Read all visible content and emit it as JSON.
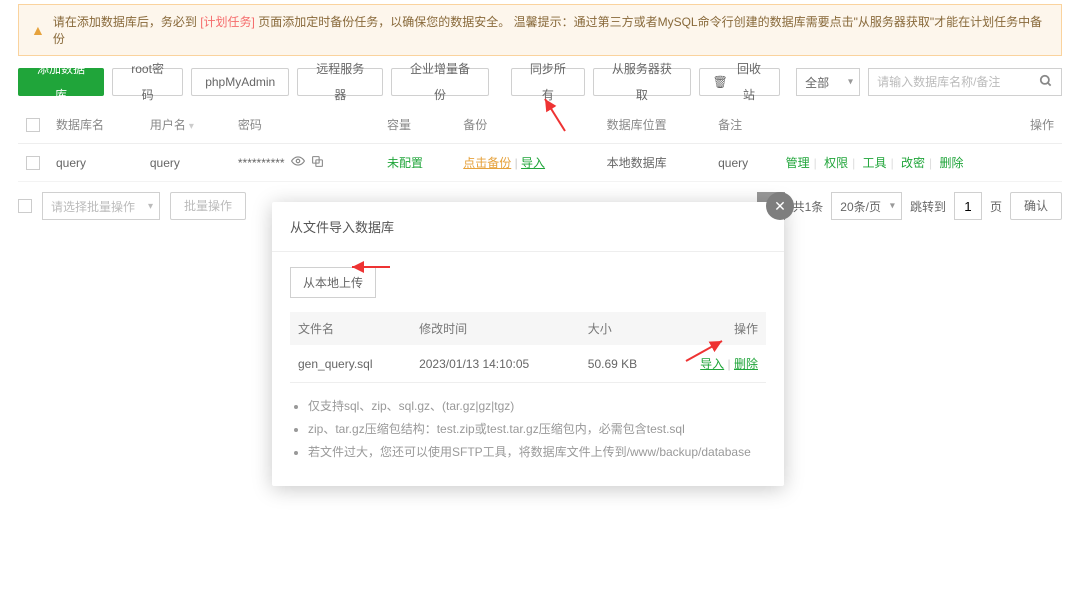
{
  "notice": {
    "prefix": "请在添加数据库后，务必到",
    "link1": "[计划任务]",
    "mid": "页面添加定时备份任务，以确保您的数据安全。 温馨提示：通过第三方或者MySQL命令行创建的数据库需要点击\"从服务器获取\"才能在计划任务中备份"
  },
  "toolbar": {
    "add_db": "添加数据库",
    "root_pwd": "root密码",
    "phpmyadmin": "phpMyAdmin",
    "remote_server": "远程服务器",
    "enterprise_backup": "企业增量备份",
    "sync_all": "同步所有",
    "fetch_server": "从服务器获取",
    "recycle_bin": "回收站",
    "filter_all": "全部"
  },
  "search": {
    "placeholder": "请输入数据库名称/备注"
  },
  "columns": {
    "db_name": "数据库名",
    "user": "用户名",
    "password": "密码",
    "capacity": "容量",
    "backup": "备份",
    "location": "数据库位置",
    "remark": "备注",
    "opt": "操作"
  },
  "row": {
    "db_name": "query",
    "user": "query",
    "password": "**********",
    "capacity": "未配置",
    "backup_click": "点击备份",
    "backup_import": "导入",
    "location": "本地数据库",
    "remark": "query",
    "actions": {
      "manage": "管理",
      "perm": "权限",
      "tool": "工具",
      "modpwd": "改密",
      "del": "删除"
    }
  },
  "batch": {
    "placeholder": "请选择批量操作",
    "apply": "批量操作"
  },
  "pager": {
    "page": "1",
    "total": "共1条",
    "per_page": "20条/页",
    "goto": "跳转到",
    "goto_val": "1",
    "page_suffix": "页",
    "confirm": "确认"
  },
  "modal": {
    "title": "从文件导入数据库",
    "upload": "从本地上传",
    "cols": {
      "filename": "文件名",
      "mtime": "修改时间",
      "size": "大小",
      "opt": "操作"
    },
    "file": {
      "name": "gen_query.sql",
      "time": "2023/01/13 14:10:05",
      "size": "50.69 KB",
      "import": "导入",
      "del": "删除"
    },
    "notes": [
      "仅支持sql、zip、sql.gz、(tar.gz|gz|tgz)",
      "zip、tar.gz压缩包结构：test.zip或test.tar.gz压缩包内，必需包含test.sql",
      "若文件过大，您还可以使用SFTP工具，将数据库文件上传到/www/backup/database"
    ]
  },
  "icons": {
    "recycle": "回"
  }
}
